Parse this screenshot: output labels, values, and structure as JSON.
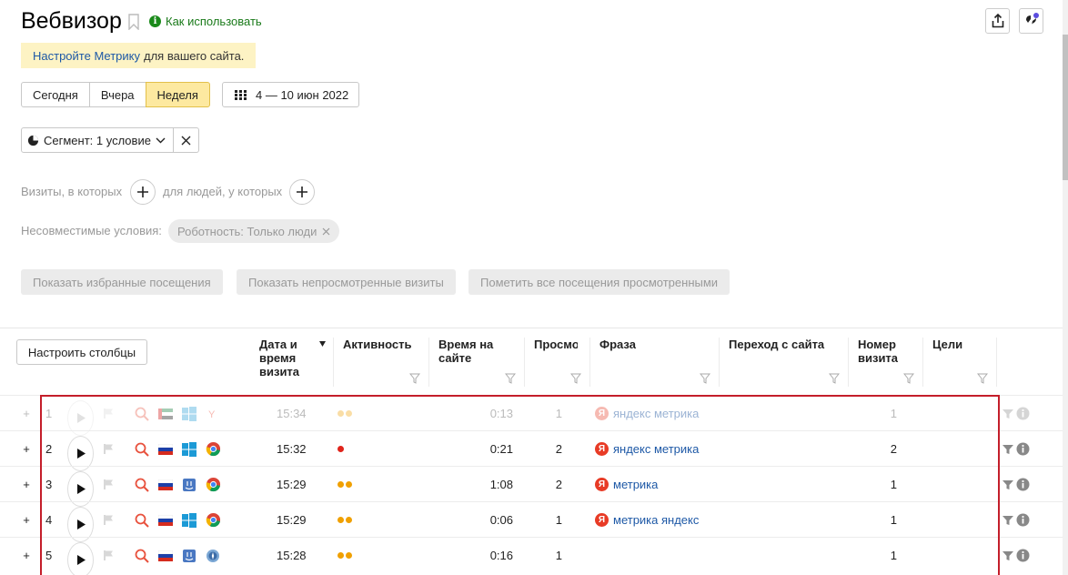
{
  "page": {
    "title": "Вебвизор",
    "how_to": "Как использовать",
    "notice_link": "Настройте Метрику",
    "notice_text": "для вашего сайта."
  },
  "periods": [
    "Сегодня",
    "Вчера",
    "Неделя"
  ],
  "period_active": "Неделя",
  "date_range": "4 — 10 июн 2022",
  "segment_label": "Сегмент: 1 условие",
  "conditions": {
    "visits_label": "Визиты, в которых",
    "people_label": "для людей, у которых",
    "incompatible_label": "Несовместимые условия:",
    "chip": "Роботность: Только люди"
  },
  "actions": {
    "show_favorites": "Показать избранные посещения",
    "show_unviewed": "Показать непросмотренные визиты",
    "mark_viewed": "Пометить все посещения просмотренными"
  },
  "table": {
    "configure_columns": "Настроить столбцы",
    "headers": {
      "datetime": "Дата и\nвремя\nвизита",
      "activity": "Активность",
      "time_on_site": "Время на\nсайте",
      "views": "Просмо",
      "phrase": "Фраза",
      "referrer": "Переход с сайта",
      "visit_number": "Номер\nвизита",
      "goals": "Цели"
    },
    "rows": [
      {
        "n": "1",
        "time": "15:34",
        "activity": 2,
        "duration": "0:13",
        "views": "1",
        "phrase": "яндекс метрика",
        "visit": "1",
        "os": "windows",
        "browser": "yandex",
        "dim": true,
        "flag": "ae"
      },
      {
        "n": "2",
        "time": "15:32",
        "activity": 1,
        "duration": "0:21",
        "views": "2",
        "phrase": "яндекс метрика",
        "visit": "2",
        "os": "windows",
        "browser": "chrome",
        "dim": false,
        "flag": "ru"
      },
      {
        "n": "3",
        "time": "15:29",
        "activity": 2,
        "duration": "1:08",
        "views": "2",
        "phrase": "метрика",
        "visit": "1",
        "os": "mac",
        "browser": "chrome",
        "dim": false,
        "flag": "ru"
      },
      {
        "n": "4",
        "time": "15:29",
        "activity": 2,
        "duration": "0:06",
        "views": "1",
        "phrase": "метрика яндекс",
        "visit": "1",
        "os": "windows",
        "browser": "chrome",
        "dim": false,
        "flag": "ru"
      },
      {
        "n": "5",
        "time": "15:28",
        "activity": 2,
        "duration": "0:16",
        "views": "1",
        "phrase": "",
        "visit": "1",
        "os": "mac",
        "browser": "safari",
        "dim": false,
        "flag": "ru"
      }
    ]
  },
  "colors": {
    "accent_yellow": "#fde9a0",
    "link_blue": "#1d58a6",
    "highlight_red": "#c41e2a",
    "activity_orange": "#f0a000",
    "activity_red": "#e0241b"
  }
}
